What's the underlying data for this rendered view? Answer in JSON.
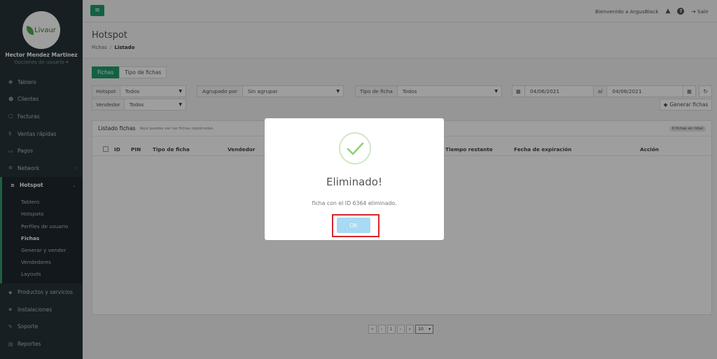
{
  "profile": {
    "logo_text": "Livaur",
    "name": "Hector Mendez Martinez",
    "options": "Opciones de usuario ▾"
  },
  "sidebar": {
    "items_top": [
      {
        "label": "Tablero",
        "icon": "dashboard-icon",
        "glyph": "◉"
      },
      {
        "label": "Clientes",
        "icon": "users-icon",
        "glyph": "☻"
      },
      {
        "label": "Facturas",
        "icon": "file-icon",
        "glyph": "▢"
      },
      {
        "label": "Ventas rápidas",
        "icon": "dollar-icon",
        "glyph": "$"
      },
      {
        "label": "Pagos",
        "icon": "card-icon",
        "glyph": "▭"
      },
      {
        "label": "Network",
        "icon": "network-icon",
        "glyph": "✲"
      }
    ],
    "hotspot": {
      "label": "Hotspot",
      "icon": "wifi-icon",
      "glyph": "≋"
    },
    "sub_items": [
      "Tablero",
      "Hotspots",
      "Perfiles de usuario",
      "Fichas",
      "Generar y vender",
      "Vendedores",
      "Layouts"
    ],
    "items_bottom": [
      {
        "label": "Productos y servicios",
        "icon": "tag-icon",
        "glyph": "◆"
      },
      {
        "label": "Instalaciones",
        "icon": "tools-icon",
        "glyph": "◈"
      },
      {
        "label": "Soporte",
        "icon": "wrench-icon",
        "glyph": "✎"
      },
      {
        "label": "Reportes",
        "icon": "book-icon",
        "glyph": "▤"
      }
    ]
  },
  "topbar": {
    "menu_glyph": "≡",
    "welcome": "Bienvenido a ArgusBlack",
    "bell": "🔔",
    "help": "?",
    "logout": "Salir"
  },
  "page": {
    "title": "Hotspot",
    "breadcrumb_root": "Fichas",
    "breadcrumb_sep": "/",
    "breadcrumb_current": "Listado"
  },
  "tabs": [
    "Fichas",
    "Tipo de fichas"
  ],
  "filters": {
    "hotspot_label": "Hotspot",
    "hotspot_value": "Todos",
    "group_label": "Agrupado por",
    "group_value": "Sin agrupar",
    "type_label": "Tipo de ficha",
    "type_value": "Todos",
    "date_from": "04/06/2021",
    "date_sep": "al",
    "date_to": "04/06/2021",
    "seller_label": "Vendedor",
    "seller_value": "Todos",
    "generate": "Generar fichas"
  },
  "panel": {
    "title": "Listado fichas",
    "subtitle": "Aquí puedes ver las fichas registradas",
    "badge": "0 fichas en total",
    "columns": {
      "id": "ID",
      "pin": "PIN",
      "type": "Tipo de ficha",
      "seller": "Vendedor",
      "remaining": "Tiempo restante",
      "expiry": "Fecha de expiración",
      "action": "Acción"
    }
  },
  "pager": {
    "first": "«",
    "prev": "‹",
    "page": "1",
    "next": "›",
    "last": "»",
    "size": "10"
  },
  "modal": {
    "title": "Eliminado!",
    "text": "ficha con el ID 6364 eliminado.",
    "ok": "OK"
  },
  "colors": {
    "accent": "#1e9e6b",
    "sidebar": "#263238",
    "ok_button": "#a9d9f3",
    "highlight": "#d9252a"
  }
}
